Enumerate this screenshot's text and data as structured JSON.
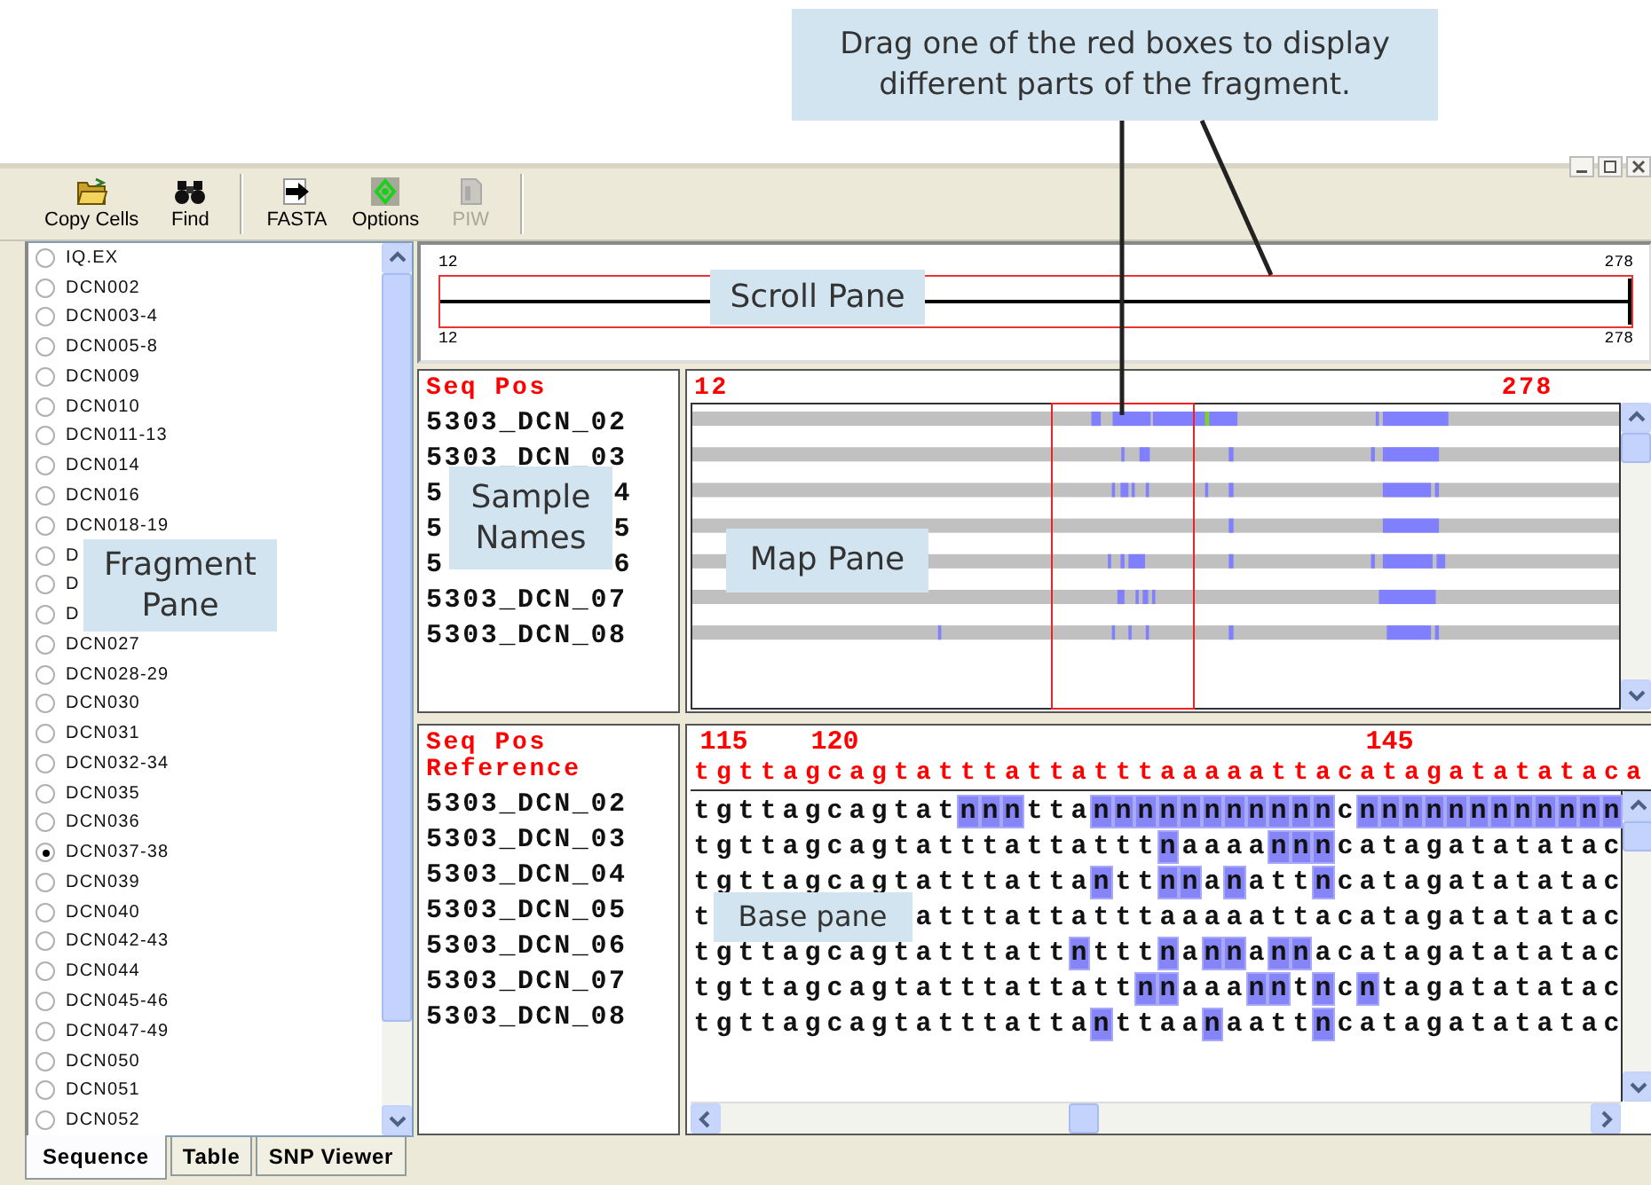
{
  "annotations": {
    "instruction": "Drag one of the red boxes to display different parts of the fragment.",
    "fragment_pane": "Fragment Pane",
    "sample_names": "Sample Names",
    "map_pane": "Map Pane",
    "scroll_pane": "Scroll Pane"
  },
  "toolbar": [
    {
      "kind": "copy",
      "label": "Copy Cells",
      "disabled": false
    },
    {
      "kind": "find",
      "label": "Find",
      "disabled": false
    },
    {
      "kind": "separator"
    },
    {
      "kind": "fasta",
      "label": "FASTA",
      "disabled": false
    },
    {
      "kind": "options",
      "label": "Options",
      "disabled": false
    },
    {
      "kind": "piw",
      "label": "PIW",
      "disabled": true
    },
    {
      "kind": "separator"
    }
  ],
  "fragments": [
    {
      "label": "IQ.EX",
      "selected": false
    },
    {
      "label": "DCN002",
      "selected": false
    },
    {
      "label": "DCN003-4",
      "selected": false
    },
    {
      "label": "DCN005-8",
      "selected": false
    },
    {
      "label": "DCN009",
      "selected": false
    },
    {
      "label": "DCN010",
      "selected": false
    },
    {
      "label": "DCN011-13",
      "selected": false
    },
    {
      "label": "DCN014",
      "selected": false
    },
    {
      "label": "DCN016",
      "selected": false
    },
    {
      "label": "DCN018-19",
      "selected": false
    },
    {
      "label": "D",
      "selected": false
    },
    {
      "label": "D",
      "selected": false
    },
    {
      "label": "D",
      "selected": false
    },
    {
      "label": "DCN027",
      "selected": false
    },
    {
      "label": "DCN028-29",
      "selected": false
    },
    {
      "label": "DCN030",
      "selected": false
    },
    {
      "label": "DCN031",
      "selected": false
    },
    {
      "label": "DCN032-34",
      "selected": false
    },
    {
      "label": "DCN035",
      "selected": false
    },
    {
      "label": "DCN036",
      "selected": false
    },
    {
      "label": "DCN037-38",
      "selected": true
    },
    {
      "label": "DCN039",
      "selected": false
    },
    {
      "label": "DCN040",
      "selected": false
    },
    {
      "label": "DCN042-43",
      "selected": false
    },
    {
      "label": "DCN044",
      "selected": false
    },
    {
      "label": "DCN045-46",
      "selected": false
    },
    {
      "label": "DCN047-49",
      "selected": false
    },
    {
      "label": "DCN050",
      "selected": false
    },
    {
      "label": "DCN051",
      "selected": false
    },
    {
      "label": "DCN052",
      "selected": false
    }
  ],
  "tabs": [
    {
      "label": "Sequence",
      "selected": true
    },
    {
      "label": "Table",
      "selected": false
    },
    {
      "label": "SNP Viewer",
      "selected": false
    }
  ],
  "scroll_pane": {
    "top_start": "12",
    "top_end": "278",
    "bottom_start": "12",
    "bottom_end": "278"
  },
  "map_pane": {
    "header": "Seq Pos",
    "start": "12",
    "end": "278",
    "samples": [
      {
        "name": "5303_DCN_02"
      },
      {
        "name": "5303_DCN_03"
      },
      {
        "name": "5",
        "tail": "4"
      },
      {
        "name": "5",
        "tail": "5"
      },
      {
        "name": "5",
        "tail": "6"
      },
      {
        "name": "5303_DCN_07"
      },
      {
        "name": "5303_DCN_08"
      }
    ]
  },
  "base_pane": {
    "header": "Seq Pos",
    "ruler": "115  120                      145",
    "reference_label": "Reference",
    "reference": "tgttagcagtatttattatttaaaaattacatagatatataca",
    "samples": [
      {
        "name": "5303_DCN_02",
        "segments": [
          {
            "kind": "base",
            "text": "tgttagcagtat",
            "marked": false
          },
          {
            "kind": "base",
            "text": "nnn",
            "marked": true
          },
          {
            "kind": "base",
            "text": "tta",
            "marked": false
          },
          {
            "kind": "base",
            "text": "nnnnnnnnnnn",
            "marked": true
          },
          {
            "kind": "base",
            "text": "c",
            "marked": false
          },
          {
            "kind": "base",
            "text": "nnnnnnnnnnnn",
            "marked": true
          }
        ]
      },
      {
        "name": "5303_DCN_03",
        "segments": [
          {
            "kind": "base",
            "text": "tgttagcagtatttattattt",
            "marked": false
          },
          {
            "kind": "base",
            "text": "n",
            "marked": true
          },
          {
            "kind": "base",
            "text": "aaaa",
            "marked": false
          },
          {
            "kind": "base",
            "text": "nnn",
            "marked": true
          },
          {
            "kind": "base",
            "text": "catagatatatac",
            "marked": false
          }
        ]
      },
      {
        "name": "5303_DCN_04",
        "segments": [
          {
            "kind": "base",
            "text": "tgttagcagtatttatta",
            "marked": false
          },
          {
            "kind": "base",
            "text": "n",
            "marked": true
          },
          {
            "kind": "base",
            "text": "tt",
            "marked": false
          },
          {
            "kind": "base",
            "text": "nn",
            "marked": true
          },
          {
            "kind": "base",
            "text": "a",
            "marked": false
          },
          {
            "kind": "base",
            "text": "n",
            "marked": true
          },
          {
            "kind": "base",
            "text": "att",
            "marked": false
          },
          {
            "kind": "base",
            "text": "n",
            "marked": true
          },
          {
            "kind": "base",
            "text": "catagatatatac",
            "marked": false
          }
        ]
      },
      {
        "name": "5303_DCN_05",
        "segments": [
          {
            "kind": "base",
            "text": "t",
            "marked": false
          },
          {
            "kind": "callout",
            "text": "Base pane"
          },
          {
            "kind": "base",
            "text": "atttattatttaaaaattacatagatatatac",
            "marked": false
          }
        ]
      },
      {
        "name": "5303_DCN_06",
        "segments": [
          {
            "kind": "base",
            "text": "tgttagcagtatttatt",
            "marked": false
          },
          {
            "kind": "base",
            "text": "n",
            "marked": true
          },
          {
            "kind": "base",
            "text": "ttt",
            "marked": false
          },
          {
            "kind": "base",
            "text": "n",
            "marked": true
          },
          {
            "kind": "base",
            "text": "a",
            "marked": false
          },
          {
            "kind": "base",
            "text": "nn",
            "marked": true
          },
          {
            "kind": "base",
            "text": "a",
            "marked": false
          },
          {
            "kind": "base",
            "text": "nn",
            "marked": true
          },
          {
            "kind": "base",
            "text": "acatagatatatac",
            "marked": false
          }
        ]
      },
      {
        "name": "5303_DCN_07",
        "segments": [
          {
            "kind": "base",
            "text": "tgttagcagtatttattatt",
            "marked": false
          },
          {
            "kind": "base",
            "text": "nn",
            "marked": true
          },
          {
            "kind": "base",
            "text": "aaa",
            "marked": false
          },
          {
            "kind": "base",
            "text": "nn",
            "marked": true
          },
          {
            "kind": "base",
            "text": "t",
            "marked": false
          },
          {
            "kind": "base",
            "text": "n",
            "marked": true
          },
          {
            "kind": "base",
            "text": "c",
            "marked": false
          },
          {
            "kind": "base",
            "text": "n",
            "marked": true
          },
          {
            "kind": "base",
            "text": "tagatatatac",
            "marked": false
          }
        ]
      },
      {
        "name": "5303_DCN_08",
        "segments": [
          {
            "kind": "base",
            "text": "tgttagcagtatttatta",
            "marked": false
          },
          {
            "kind": "base",
            "text": "n",
            "marked": true
          },
          {
            "kind": "base",
            "text": "ttaa",
            "marked": false
          },
          {
            "kind": "base",
            "text": "n",
            "marked": true
          },
          {
            "kind": "base",
            "text": "aatt",
            "marked": false
          },
          {
            "kind": "base",
            "text": "n",
            "marked": true
          },
          {
            "kind": "base",
            "text": "catagatatatac",
            "marked": false
          }
        ]
      }
    ]
  }
}
